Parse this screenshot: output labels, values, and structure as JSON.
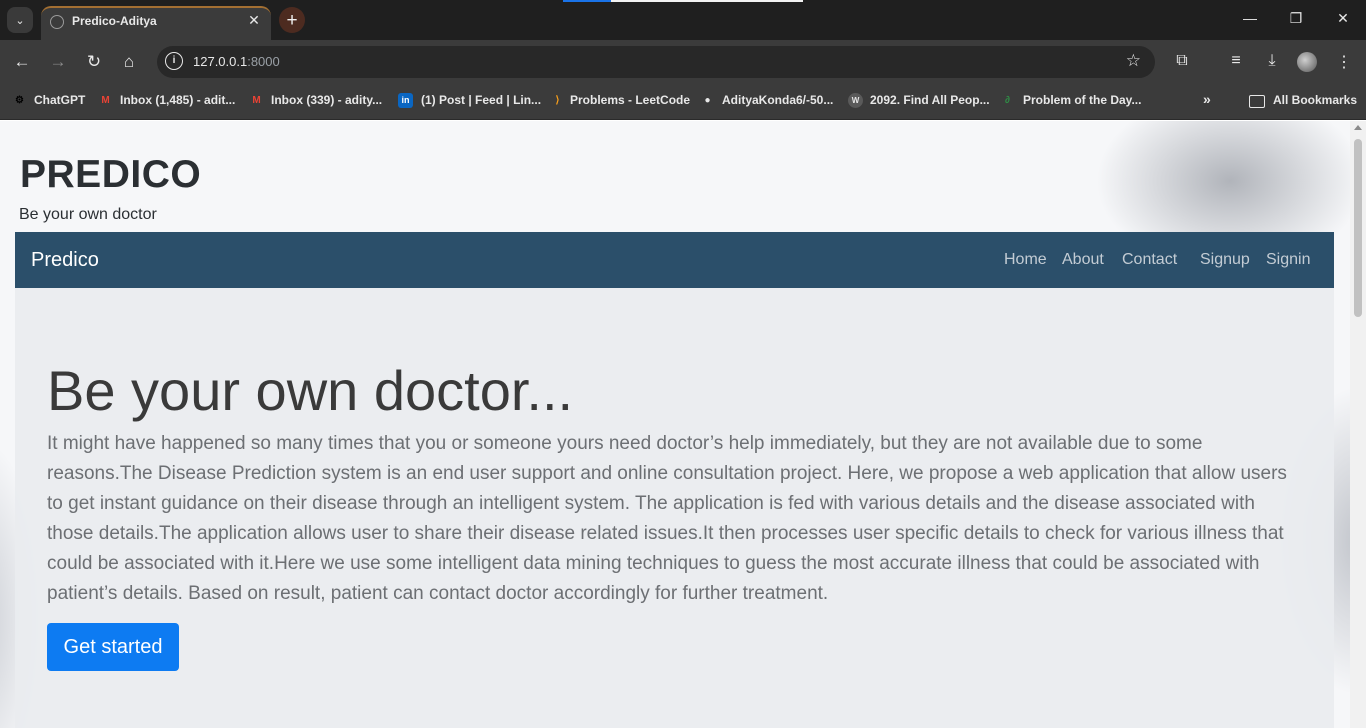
{
  "browser": {
    "tab": {
      "title": "Predico-Aditya",
      "close": "✕"
    },
    "new_tab": "+",
    "tab_search": "⌄",
    "window": {
      "minimize": "—",
      "restore": "❐",
      "close": "✕"
    },
    "nav": {
      "back": "←",
      "forward": "→",
      "reload": "↻",
      "home": "⌂"
    },
    "address": {
      "host": "127.0.0.1",
      "port": ":8000",
      "info": "i",
      "star": "☆"
    },
    "toolbar_icons": {
      "extensions": "⧉",
      "media": "≡",
      "download": "⤓",
      "menu": "⋮"
    },
    "bookmarks": [
      {
        "label": "ChatGPT",
        "icon": "chatgpt-icon",
        "glyph": "⚙",
        "color": "#e8e8e8"
      },
      {
        "label": "Inbox (1,485) - adit...",
        "icon": "gmail-icon",
        "glyph": "M",
        "color": "#ea4335"
      },
      {
        "label": "Inbox (339) - adity...",
        "icon": "gmail-icon",
        "glyph": "M",
        "color": "#ea4335"
      },
      {
        "label": "(1) Post | Feed | Lin...",
        "icon": "linkedin-icon",
        "glyph": "in",
        "color": "#0a66c2"
      },
      {
        "label": "Problems - LeetCode",
        "icon": "leetcode-icon",
        "glyph": "⟩",
        "color": "#f89f1b"
      },
      {
        "label": "AdityaKonda6/-50...",
        "icon": "github-icon",
        "glyph": "●",
        "color": "#e8e8e8"
      },
      {
        "label": "2092. Find All Peop...",
        "icon": "web-icon",
        "glyph": "W",
        "color": "#e8e8e8"
      },
      {
        "label": "Problem of the Day...",
        "icon": "gfg-icon",
        "glyph": "∂",
        "color": "#2f8d46"
      }
    ],
    "bookmarks_overflow": "»",
    "all_bookmarks": "All Bookmarks"
  },
  "site": {
    "brand_title": "PREDICO",
    "tagline": "Be your own doctor",
    "navbar": {
      "brand": "Predico",
      "links": [
        "Home",
        "About",
        "Contact",
        "Signup",
        "Signin"
      ]
    },
    "hero": {
      "heading": "Be your own doctor...",
      "lead": "It might have happened so many times that you or someone yours need doctor’s help immediately, but they are not available due to some reasons.The Disease Prediction system is an end user support and online consultation project. Here, we propose a web application that allow users to get instant guidance on their disease through an intelligent system. The application is fed with various details and the disease associated with those details.The application allows user to share their disease related issues.It then processes user specific details to check for various illness that could be associated with it.Here we use some intelligent data mining techniques to guess the most accurate illness that could be associated with patient’s details. Based on result, patient can contact doctor accordingly for further treatment.",
      "cta": "Get started"
    }
  },
  "colors": {
    "navbar": "#2b4f6a",
    "cta": "#0d7bf2",
    "tab_accent": "#a36f32"
  }
}
